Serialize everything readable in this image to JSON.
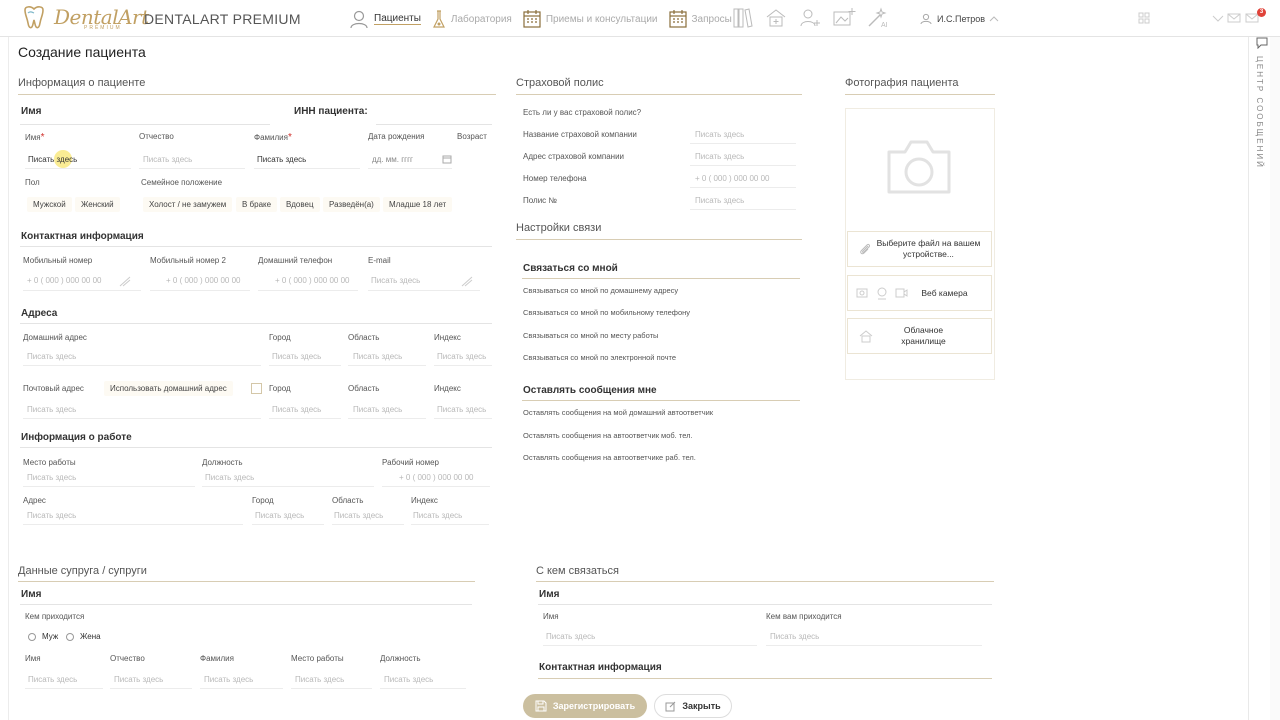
{
  "header": {
    "logo_word": "DentalArt",
    "logo_premium": "PREMIUM",
    "brand": "DENTALART PREMIUM",
    "nav": [
      {
        "label": "Пациенты",
        "icon": "patients-icon",
        "active": true
      },
      {
        "label": "Лаборатория",
        "icon": "laboratory-icon",
        "active": false
      },
      {
        "label": "Приемы и консультации",
        "icon": "calendar-icon",
        "active": false
      },
      {
        "label": "Запросы",
        "icon": "requests-calendar-icon",
        "active": false
      }
    ],
    "user": "И.С.Петров",
    "messages_count": "3",
    "side_panel_label": "Центр сообщений"
  },
  "page": {
    "title": "Создание пациента"
  },
  "patient_info": {
    "section_title": "Информация о пациенте",
    "name_title": "Имя",
    "inn_title": "ИНН пациента:",
    "first_name_label": "Имя",
    "first_name_value": "Писать здесь",
    "middle_name_label": "Отчество",
    "middle_name_placeholder": "Писать здесь",
    "last_name_label": "Фамилия",
    "last_name_value": "Писать здесь",
    "dob_label": "Дата рождения",
    "dob_placeholder": "дд. мм. гггг",
    "age_label": "Возраст",
    "gender_label": "Пол",
    "gender_options": [
      "Мужской",
      "Женский"
    ],
    "marital_label": "Семейное положение",
    "marital_options": [
      "Холост / не замужем",
      "В браке",
      "Вдовец",
      "Разведён(а)",
      "Младше 18 лет"
    ]
  },
  "contact_info": {
    "title": "Контактная информация",
    "mobile_label": "Мобильный номер",
    "mobile_placeholder": "+ 0 ( 000 ) 000 00 00",
    "mobile2_label": "Мобильный номер 2",
    "mobile2_placeholder": "+ 0 ( 000 ) 000 00 00",
    "home_phone_label": "Домашний телефон",
    "home_phone_placeholder": "+ 0 ( 000 ) 000 00 00",
    "email_label": "E-mail",
    "email_placeholder": "Писать здесь"
  },
  "addresses": {
    "title": "Адреса",
    "home_address_label": "Домашний адрес",
    "city_label": "Город",
    "region_label": "Область",
    "index_label": "Индекс",
    "placeholder": "Писать здесь",
    "postal_address_label": "Почтовый адрес",
    "use_home_address": "Использовать домашний адрес"
  },
  "work_info": {
    "title": "Информация о работе",
    "workplace_label": "Место работы",
    "position_label": "Должность",
    "work_phone_label": "Рабочий номер",
    "work_phone_placeholder": "+ 0 ( 000 ) 000 00 00",
    "address_label": "Адрес",
    "city_label": "Город",
    "region_label": "Область",
    "index_label": "Индекс",
    "placeholder": "Писать здесь"
  },
  "insurance": {
    "title": "Страховой полис",
    "has_policy_label": "Есть ли у вас страховой полис?",
    "company_label": "Название страховой компании",
    "company_address_label": "Адрес страховой компании",
    "phone_label": "Номер телефона",
    "policy_label": "Полис №",
    "placeholder": "Писать здесь",
    "phone_placeholder": "+ 0 ( 000 ) 000 00 00"
  },
  "communication": {
    "title": "Настройки связи",
    "contact_me_title": "Связаться со мной",
    "contact_me_options": [
      "Связываться со мной по домашнему адресу",
      "Связываться со мной по мобильному телефону",
      "Связываться со мной по месту работы",
      "Связываться со мной по электронной почте"
    ],
    "leave_messages_title": "Оставлять сообщения мне",
    "leave_messages_options": [
      "Оставлять сообщения на мой домашний автоответчик",
      "Оставлять сообщения на автоответчик моб. тел.",
      "Оставлять сообщения на автоответчике раб. тел."
    ]
  },
  "photo": {
    "title": "Фотография пациента",
    "upload_label": "Выберите файл на вашем устройстве...",
    "webcam_label": "Веб камера",
    "cloud_label": "Облачное хранилище"
  },
  "spouse": {
    "section_title": "Данные супруга / супруги",
    "name_title": "Имя",
    "relation_label": "Кем приходится",
    "relation_options": [
      "Муж",
      "Жена"
    ],
    "first_name_label": "Имя",
    "middle_name_label": "Отчество",
    "last_name_label": "Фамилия",
    "workplace_label": "Место работы",
    "position_label": "Должность",
    "placeholder": "Писать здесь"
  },
  "emergency_contact": {
    "section_title": "С кем связаться",
    "name_title": "Имя",
    "name_label": "Имя",
    "relation_label": "Кем вам приходится",
    "placeholder": "Писать здесь",
    "contact_title": "Контактная информация"
  },
  "actions": {
    "register_label": "Зарегистрировать",
    "close_label": "Закрыть"
  },
  "colors": {
    "accent_gold": "#c1a063",
    "button_disabled": "#cbbf9f",
    "badge_red": "#e0433a"
  }
}
